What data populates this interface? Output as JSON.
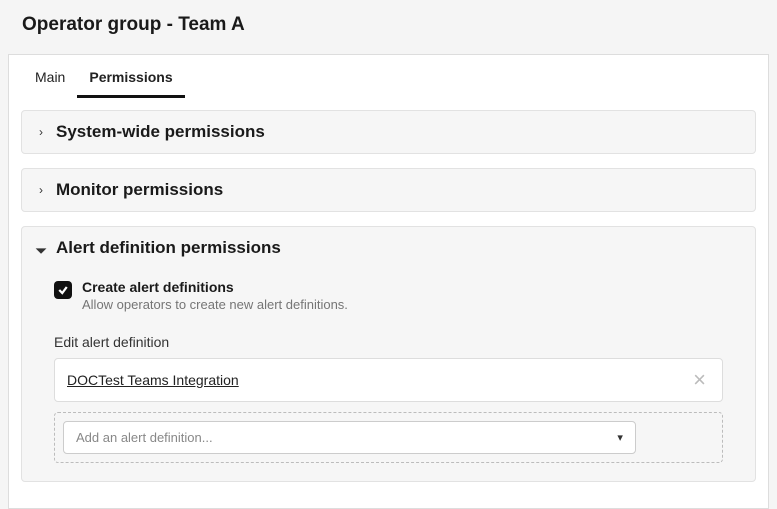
{
  "header": {
    "title": "Operator group - Team A"
  },
  "tabs": [
    {
      "label": "Main",
      "active": false
    },
    {
      "label": "Permissions",
      "active": true
    }
  ],
  "sections": {
    "system_wide": {
      "title": "System-wide permissions",
      "expanded": false
    },
    "monitor": {
      "title": "Monitor permissions",
      "expanded": false
    },
    "alert_def": {
      "title": "Alert definition permissions",
      "expanded": true,
      "create": {
        "label": "Create alert definitions",
        "description": "Allow operators to create new alert definitions.",
        "checked": true
      },
      "edit_field": {
        "label": "Edit alert definition",
        "selected": "DOCTest Teams Integration",
        "add_placeholder": "Add an alert definition..."
      }
    }
  }
}
